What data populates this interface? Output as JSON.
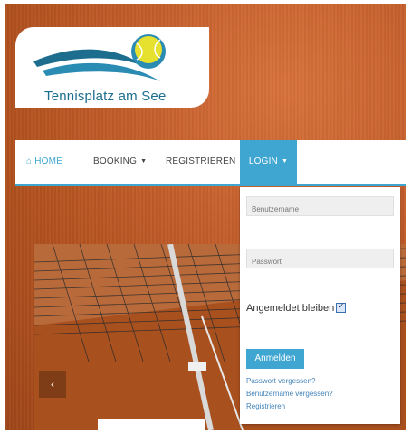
{
  "logo": {
    "text": "Tennisplatz am See"
  },
  "nav": {
    "home": "HOME",
    "booking": "BOOKING",
    "register": "REGISTRIEREN",
    "login": "LOGIN"
  },
  "login_form": {
    "username_placeholder": "Benutzername",
    "password_placeholder": "Passwort",
    "remember_label": "Angemeldet bleiben",
    "remember_checked": true,
    "submit_label": "Anmelden",
    "links": [
      "Passwort vergessen?",
      "Benutzername vergessen?",
      "Registrieren"
    ]
  },
  "slider": {
    "prev_arrow": "‹"
  },
  "colors": {
    "accent": "#3fa6d1",
    "clay": "#c45e2c",
    "ball": "#e2e233",
    "logo_blue": "#1d6d8f"
  }
}
